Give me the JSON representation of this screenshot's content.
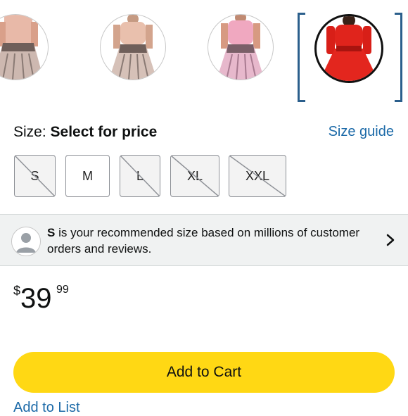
{
  "swatches": [
    {
      "name": "swatch-pink-top-patterned-skirt"
    },
    {
      "name": "swatch-beige-top-patterned-skirt"
    },
    {
      "name": "swatch-pink-top-pink-skirt"
    },
    {
      "name": "swatch-red-dress",
      "selected": true
    }
  ],
  "size": {
    "label": "Size:",
    "value": "Select for price",
    "guide": "Size guide",
    "options": [
      "S",
      "M",
      "L",
      "XL",
      "XXL"
    ],
    "available": [
      false,
      true,
      false,
      false,
      false
    ]
  },
  "recommendation": {
    "size": "S",
    "text": " is your recommended size based on millions of customer orders and reviews."
  },
  "price": {
    "symbol": "$",
    "whole": "39",
    "fraction": "99"
  },
  "actions": {
    "add_to_cart": "Add to Cart",
    "add_to_list": "Add to List"
  },
  "colors": {
    "accent": "#ffd814",
    "link": "#1c6aa8",
    "selected_border": "#2b5f8c"
  }
}
